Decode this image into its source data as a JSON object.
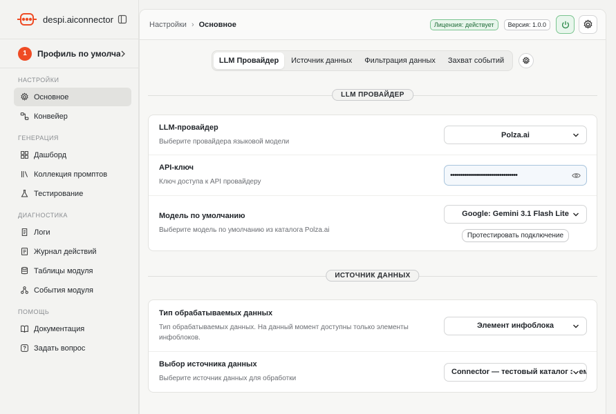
{
  "app": {
    "name": "despi.aiconnector"
  },
  "profile": {
    "badge": "1",
    "name": "Профиль по умолчан..."
  },
  "sidebar": {
    "sections": [
      {
        "title": "НАСТРОЙКИ",
        "items": [
          {
            "label": "Основное",
            "icon": "gear-icon",
            "active": true
          },
          {
            "label": "Конвейер",
            "icon": "pipeline-icon"
          }
        ]
      },
      {
        "title": "ГЕНЕРАЦИЯ",
        "items": [
          {
            "label": "Дашборд",
            "icon": "dashboard-icon"
          },
          {
            "label": "Коллекция промптов",
            "icon": "library-icon"
          },
          {
            "label": "Тестирование",
            "icon": "flask-icon"
          }
        ]
      },
      {
        "title": "ДИАГНОСТИКА",
        "items": [
          {
            "label": "Логи",
            "icon": "logs-icon"
          },
          {
            "label": "Журнал действий",
            "icon": "journal-icon"
          },
          {
            "label": "Таблицы модуля",
            "icon": "database-icon"
          },
          {
            "label": "События модуля",
            "icon": "events-icon"
          }
        ]
      },
      {
        "title": "ПОМОЩЬ",
        "items": [
          {
            "label": "Документация",
            "icon": "book-icon"
          },
          {
            "label": "Задать вопрос",
            "icon": "question-icon"
          }
        ]
      }
    ]
  },
  "header": {
    "breadcrumb_parent": "Настройки",
    "breadcrumb_current": "Основное",
    "license": "Лицензия: действует",
    "version": "Версия: 1.0.0"
  },
  "tabs": [
    "LLM Провайдер",
    "Источник данных",
    "Фильтрация данных",
    "Захват событий"
  ],
  "llm_section": {
    "title": "LLM ПРОВАЙДЕР",
    "provider": {
      "label": "LLM-провайдер",
      "desc": "Выберите провайдера языковой модели",
      "value": "Polza.ai"
    },
    "api_key": {
      "label": "API-ключ",
      "desc": "Ключ доступа к API провайдеру",
      "value": "••••••••••••••••••••••••••••••••••"
    },
    "model": {
      "label": "Модель по умолчанию",
      "desc": "Выберите модель по умолчанию из каталога Polza.ai",
      "value": "Google: Gemini 3.1 Flash Lite",
      "test_button": "Протестировать подключение"
    }
  },
  "data_section": {
    "title": "ИСТОЧНИК ДАННЫХ",
    "type": {
      "label": "Тип обрабатываемых данных",
      "desc": "Тип обрабатываемых данных. На данный момент доступны только элементы инфоблоков.",
      "value": "Элемент инфоблока"
    },
    "source": {
      "label": "Выбор источника данных",
      "desc": "Выберите источник данных для обработки",
      "value": "Connector — тестовый каталог элементов"
    }
  },
  "colors": {
    "accent": "#ef4b24",
    "success": "#1e6b37",
    "success_bg": "#e8f6ec"
  }
}
